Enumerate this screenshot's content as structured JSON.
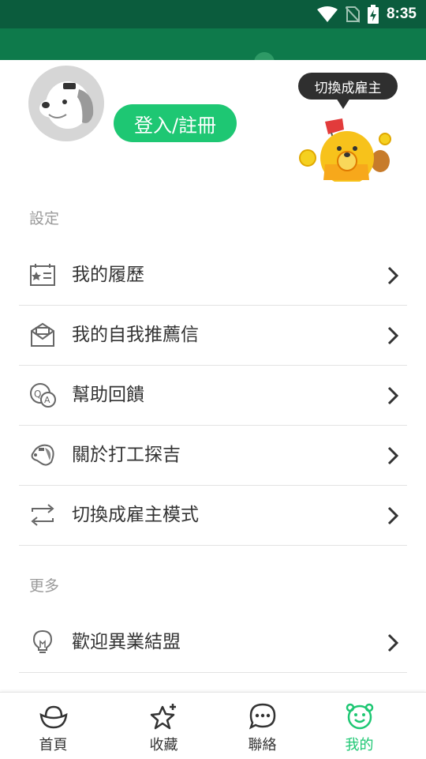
{
  "status_bar": {
    "time": "8:35",
    "icons": [
      "wifi-icon",
      "no-sim-icon",
      "battery-charging-icon"
    ]
  },
  "header": {
    "login_label": "登入/註冊",
    "switch_bubble": "切換成雇主"
  },
  "settings": {
    "label": "設定",
    "items": [
      {
        "label": "我的履歷",
        "icon": "resume-icon"
      },
      {
        "label": "我的自我推薦信",
        "icon": "envelope-icon"
      },
      {
        "label": "幫助回饋",
        "icon": "qa-feedback-icon"
      },
      {
        "label": "關於打工探吉",
        "icon": "dog-head-icon"
      },
      {
        "label": "切換成雇主模式",
        "icon": "swap-arrows-icon"
      }
    ]
  },
  "more": {
    "label": "更多",
    "items": [
      {
        "label": "歡迎異業結盟",
        "icon": "lightbulb-icon"
      }
    ]
  },
  "bottom_nav": {
    "items": [
      {
        "label": "首頁",
        "icon": "ingot-icon"
      },
      {
        "label": "收藏",
        "icon": "star-add-icon"
      },
      {
        "label": "聯絡",
        "icon": "chat-icon"
      },
      {
        "label": "我的",
        "icon": "bear-face-icon",
        "active": true
      }
    ]
  },
  "colors": {
    "status_bar": "#0b5c3d",
    "app_bar": "#0e7a4b",
    "accent": "#1ec773",
    "text": "#333333",
    "muted": "#9a9a9a"
  }
}
